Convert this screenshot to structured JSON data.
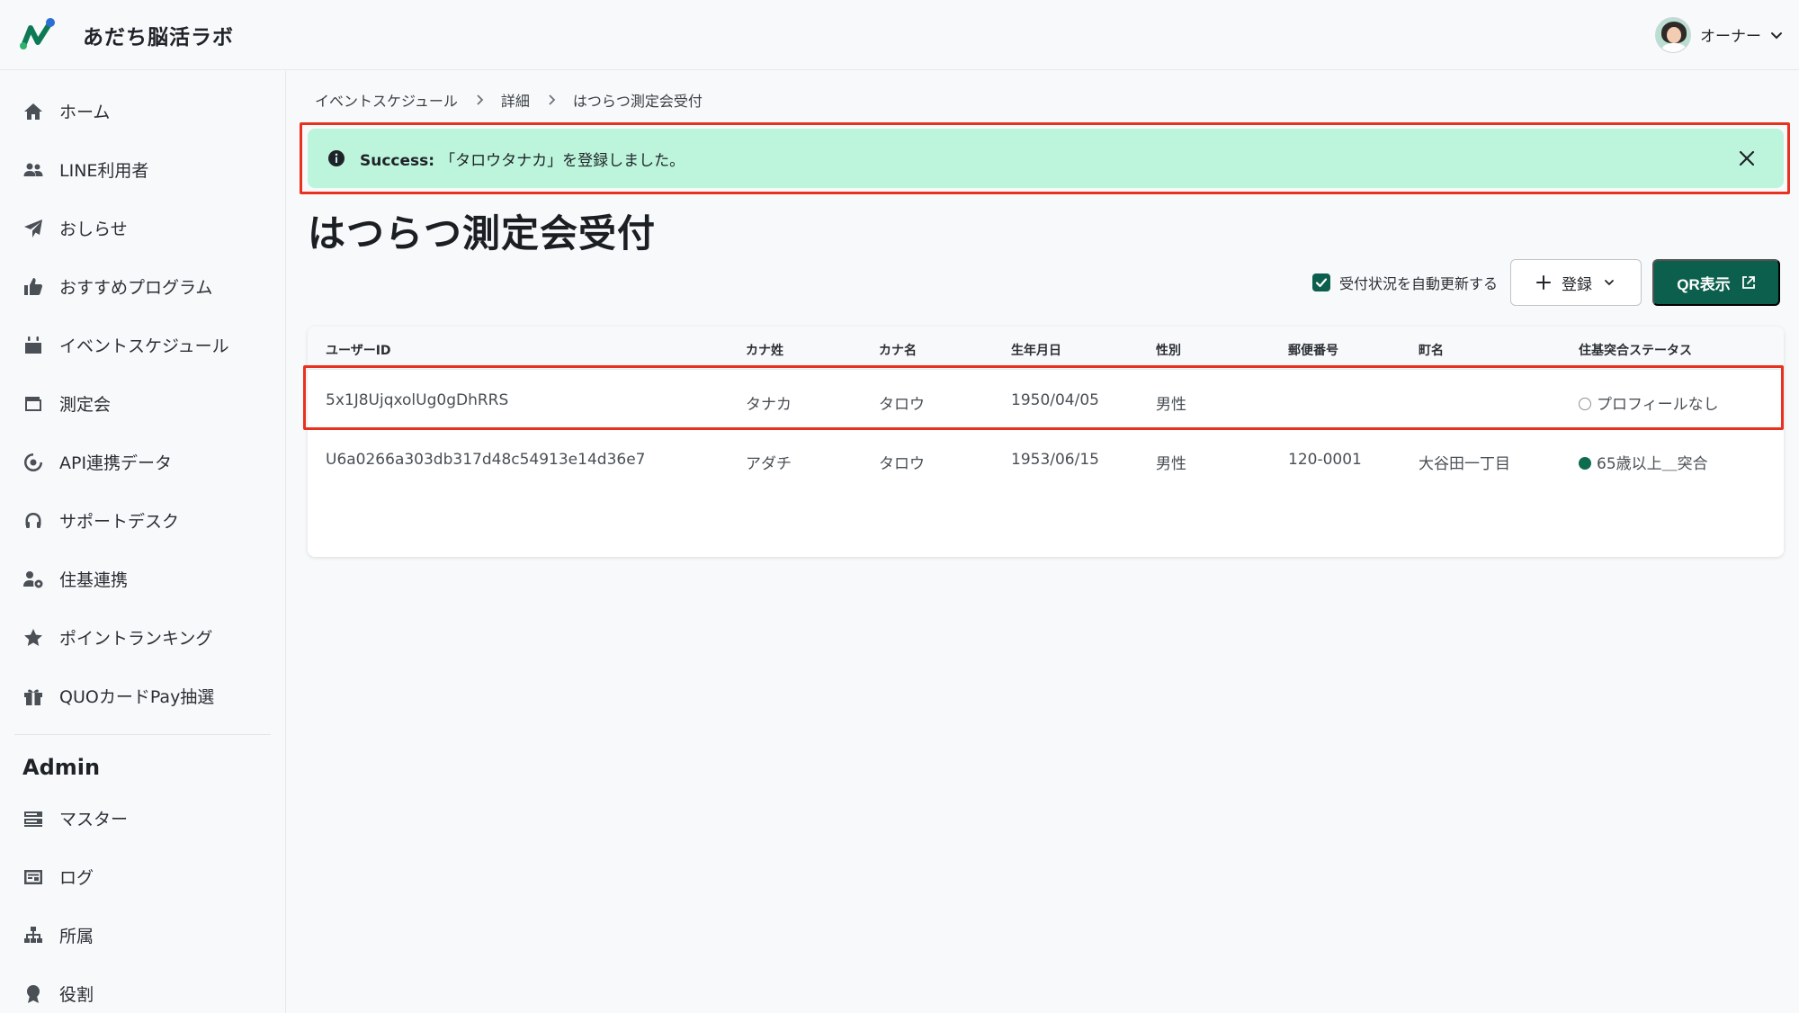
{
  "app": {
    "name": "あだち脳活ラボ"
  },
  "user": {
    "name": "オーナー"
  },
  "sidebar": {
    "items": [
      {
        "label": "ホーム",
        "icon": "home-icon"
      },
      {
        "label": "LINE利用者",
        "icon": "users-icon"
      },
      {
        "label": "おしらせ",
        "icon": "paper-plane-icon"
      },
      {
        "label": "おすすめプログラム",
        "icon": "thumbs-up-icon"
      },
      {
        "label": "イベントスケジュール",
        "icon": "calendar-icon"
      },
      {
        "label": "測定会",
        "icon": "wallet-icon"
      },
      {
        "label": "API連携データ",
        "icon": "sync-icon"
      },
      {
        "label": "サポートデスク",
        "icon": "headset-icon"
      },
      {
        "label": "住基連携",
        "icon": "user-gear-icon"
      },
      {
        "label": "ポイントランキング",
        "icon": "star-icon"
      },
      {
        "label": "QUOカードPay抽選",
        "icon": "gift-icon"
      }
    ],
    "admin_heading": "Admin",
    "admin_items": [
      {
        "label": "マスター",
        "icon": "server-icon"
      },
      {
        "label": "ログ",
        "icon": "log-icon"
      },
      {
        "label": "所属",
        "icon": "org-chart-icon"
      },
      {
        "label": "役割",
        "icon": "badge-icon"
      }
    ]
  },
  "breadcrumb": [
    "イベントスケジュール",
    "詳細",
    "はつらつ測定会受付"
  ],
  "alert": {
    "prefix": "Success:",
    "message": "「タロウタナカ」を登録しました。"
  },
  "page": {
    "title": "はつらつ測定会受付"
  },
  "toolbar": {
    "auto_refresh_label": "受付状況を自動更新する",
    "auto_refresh_checked": true,
    "register_label": "登録",
    "qr_label": "QR表示"
  },
  "table": {
    "columns": [
      "ユーザーID",
      "カナ姓",
      "カナ名",
      "生年月日",
      "性別",
      "郵便番号",
      "町名",
      "住基突合ステータス"
    ],
    "rows": [
      {
        "user_id": "5x1J8UjqxolUg0gDhRRS",
        "kana_last": "タナカ",
        "kana_first": "タロウ",
        "birthdate": "1950/04/05",
        "gender": "男性",
        "postal": "",
        "town": "",
        "status": "プロフィールなし",
        "status_kind": "empty"
      },
      {
        "user_id": "U6a0266a303db317d48c54913e14d36e7",
        "kana_last": "アダチ",
        "kana_first": "タロウ",
        "birthdate": "1953/06/15",
        "gender": "男性",
        "postal": "120-0001",
        "town": "大谷田一丁目",
        "status": "65歳以上＿突合",
        "status_kind": "matched"
      }
    ]
  },
  "colors": {
    "brand_green": "#0d5f4d",
    "alert_bg": "#bdf5dc",
    "annotation_red": "#e8321f"
  }
}
